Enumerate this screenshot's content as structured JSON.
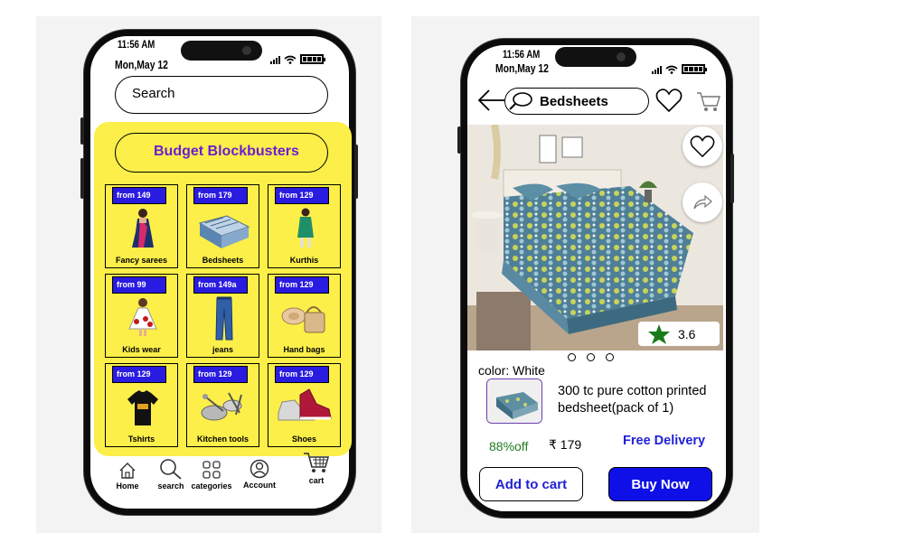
{
  "left_phone": {
    "status": {
      "time": "11:56 AM",
      "date": "Mon,May 12"
    },
    "search": {
      "placeholder": "Search"
    },
    "section_title": "Budget Blockbusters",
    "categories": [
      {
        "price": "from    149",
        "label": "Fancy sarees",
        "icon": "saree-woman-icon"
      },
      {
        "price": "from 179",
        "label": "Bedsheets",
        "icon": "bedsheet-icon"
      },
      {
        "price": "from 129",
        "label": "Kurthis",
        "icon": "kurthi-woman-icon"
      },
      {
        "price": "from 99",
        "label": "Kids wear",
        "icon": "kids-dress-icon"
      },
      {
        "price": "from 149a",
        "label": "jeans",
        "icon": "jeans-icon"
      },
      {
        "price": "from 129",
        "label": "Hand bags",
        "icon": "handbag-icon"
      },
      {
        "price": "from 129",
        "label": "Tshirts",
        "icon": "tshirt-icon"
      },
      {
        "price": "from 129",
        "label": "Kitchen tools",
        "icon": "kitchen-tools-icon"
      },
      {
        "price": "from 129",
        "label": "Shoes",
        "icon": "shoe-icon"
      }
    ],
    "nav": [
      {
        "label": "Home",
        "icon": "home-icon"
      },
      {
        "label": "search",
        "icon": "search-icon"
      },
      {
        "label": "categories",
        "icon": "categories-icon"
      },
      {
        "label": "Account",
        "icon": "account-icon"
      },
      {
        "label": "cart",
        "icon": "cart-icon"
      }
    ],
    "accent_yellow": "#fcef49",
    "price_tag_color": "#2a1be0",
    "title_color": "#6b1fd1"
  },
  "right_phone": {
    "status": {
      "time": "11:56 AM",
      "date": "Mon,May 12"
    },
    "search_query": "Bedsheets",
    "rating": "3.6",
    "color_label": "color: White",
    "description": "300 tc pure cotton printed bedsheet(pack of 1)",
    "discount": "88%off",
    "price": "₹ 179",
    "delivery": "Free Delivery",
    "add_to_cart": "Add to cart",
    "buy_now": "Buy Now",
    "carousel_pages": 3,
    "buy_color": "#0f0fe8",
    "link_color": "#1f1fd6",
    "discount_color": "#1f7a1f"
  }
}
